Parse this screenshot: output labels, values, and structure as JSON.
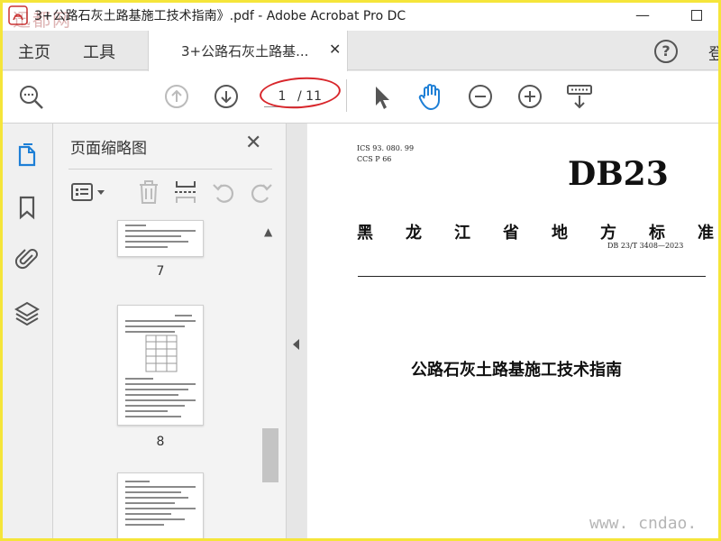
{
  "window": {
    "title": "3+公路石灰土路基施工技术指南》.pdf - Adobe Acrobat Pro DC",
    "minimize_glyph": "—",
    "watermark_top_left": "迅都网"
  },
  "menu": {
    "home": "主页",
    "tools": "工具",
    "doc_tab": "3+公路石灰土路基...",
    "help": "?",
    "signin_partial": "登"
  },
  "toolbar": {
    "current_page": "1",
    "total_pages": "/ 11",
    "highlight_color": "#d8262b"
  },
  "panel": {
    "title": "页面缩略图",
    "close": "✕",
    "thumbnails": [
      {
        "label": "7"
      },
      {
        "label": "8"
      }
    ]
  },
  "document": {
    "ics_line": "ICS  93. 080. 99",
    "ccs_line": "CCS  P  66",
    "badge": "DB23",
    "province_chars": [
      "黑",
      "龙",
      "江",
      "省",
      "地",
      "方",
      "标",
      "准"
    ],
    "standard_number": "DB 23/T  3408—2023",
    "title": "公路石灰土路基施工技术指南"
  },
  "watermark": {
    "bottom_right": "www. cndao. com"
  },
  "colors": {
    "accent_blue": "#1d7fd6",
    "frame_yellow": "#f5e53a"
  }
}
